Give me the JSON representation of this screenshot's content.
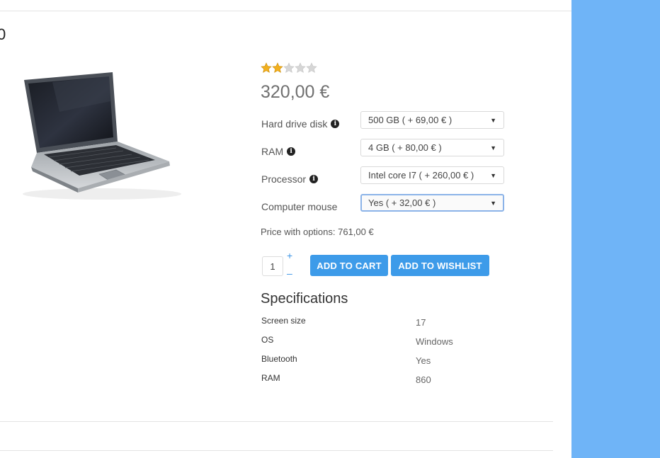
{
  "title_fragment": "0",
  "product": {
    "rating": 2,
    "rating_max": 5,
    "price": "320,00 €",
    "options": [
      {
        "label": "Hard drive disk",
        "has_info": true,
        "value": "500 GB ( + 69,00 € )"
      },
      {
        "label": "RAM",
        "has_info": true,
        "value": "4 GB ( + 80,00 € )"
      },
      {
        "label": "Processor",
        "has_info": true,
        "value": "Intel core I7 ( + 260,00 € )"
      },
      {
        "label": "Computer mouse",
        "has_info": false,
        "value": "Yes ( + 32,00 € )"
      }
    ],
    "price_with_options": "Price with options: 761,00 €",
    "quantity": "1",
    "qty_plus": "+",
    "qty_minus": "–",
    "add_to_cart": "ADD TO CART",
    "add_to_wishlist": "ADD TO WISHLIST"
  },
  "specifications": {
    "title": "Specifications",
    "rows": [
      {
        "name": "Screen size",
        "value": "17"
      },
      {
        "name": "OS",
        "value": "Windows"
      },
      {
        "name": "Bluetooth",
        "value": "Yes"
      },
      {
        "name": "RAM",
        "value": "860"
      }
    ]
  },
  "icons": {
    "info": "info-icon",
    "caret": "chevron-down-icon",
    "star": "star-icon"
  },
  "colors": {
    "accent": "#3d9be9",
    "side_panel": "#6fb4f7",
    "star_filled": "#f2b01e",
    "star_empty": "#d6d6d6"
  }
}
